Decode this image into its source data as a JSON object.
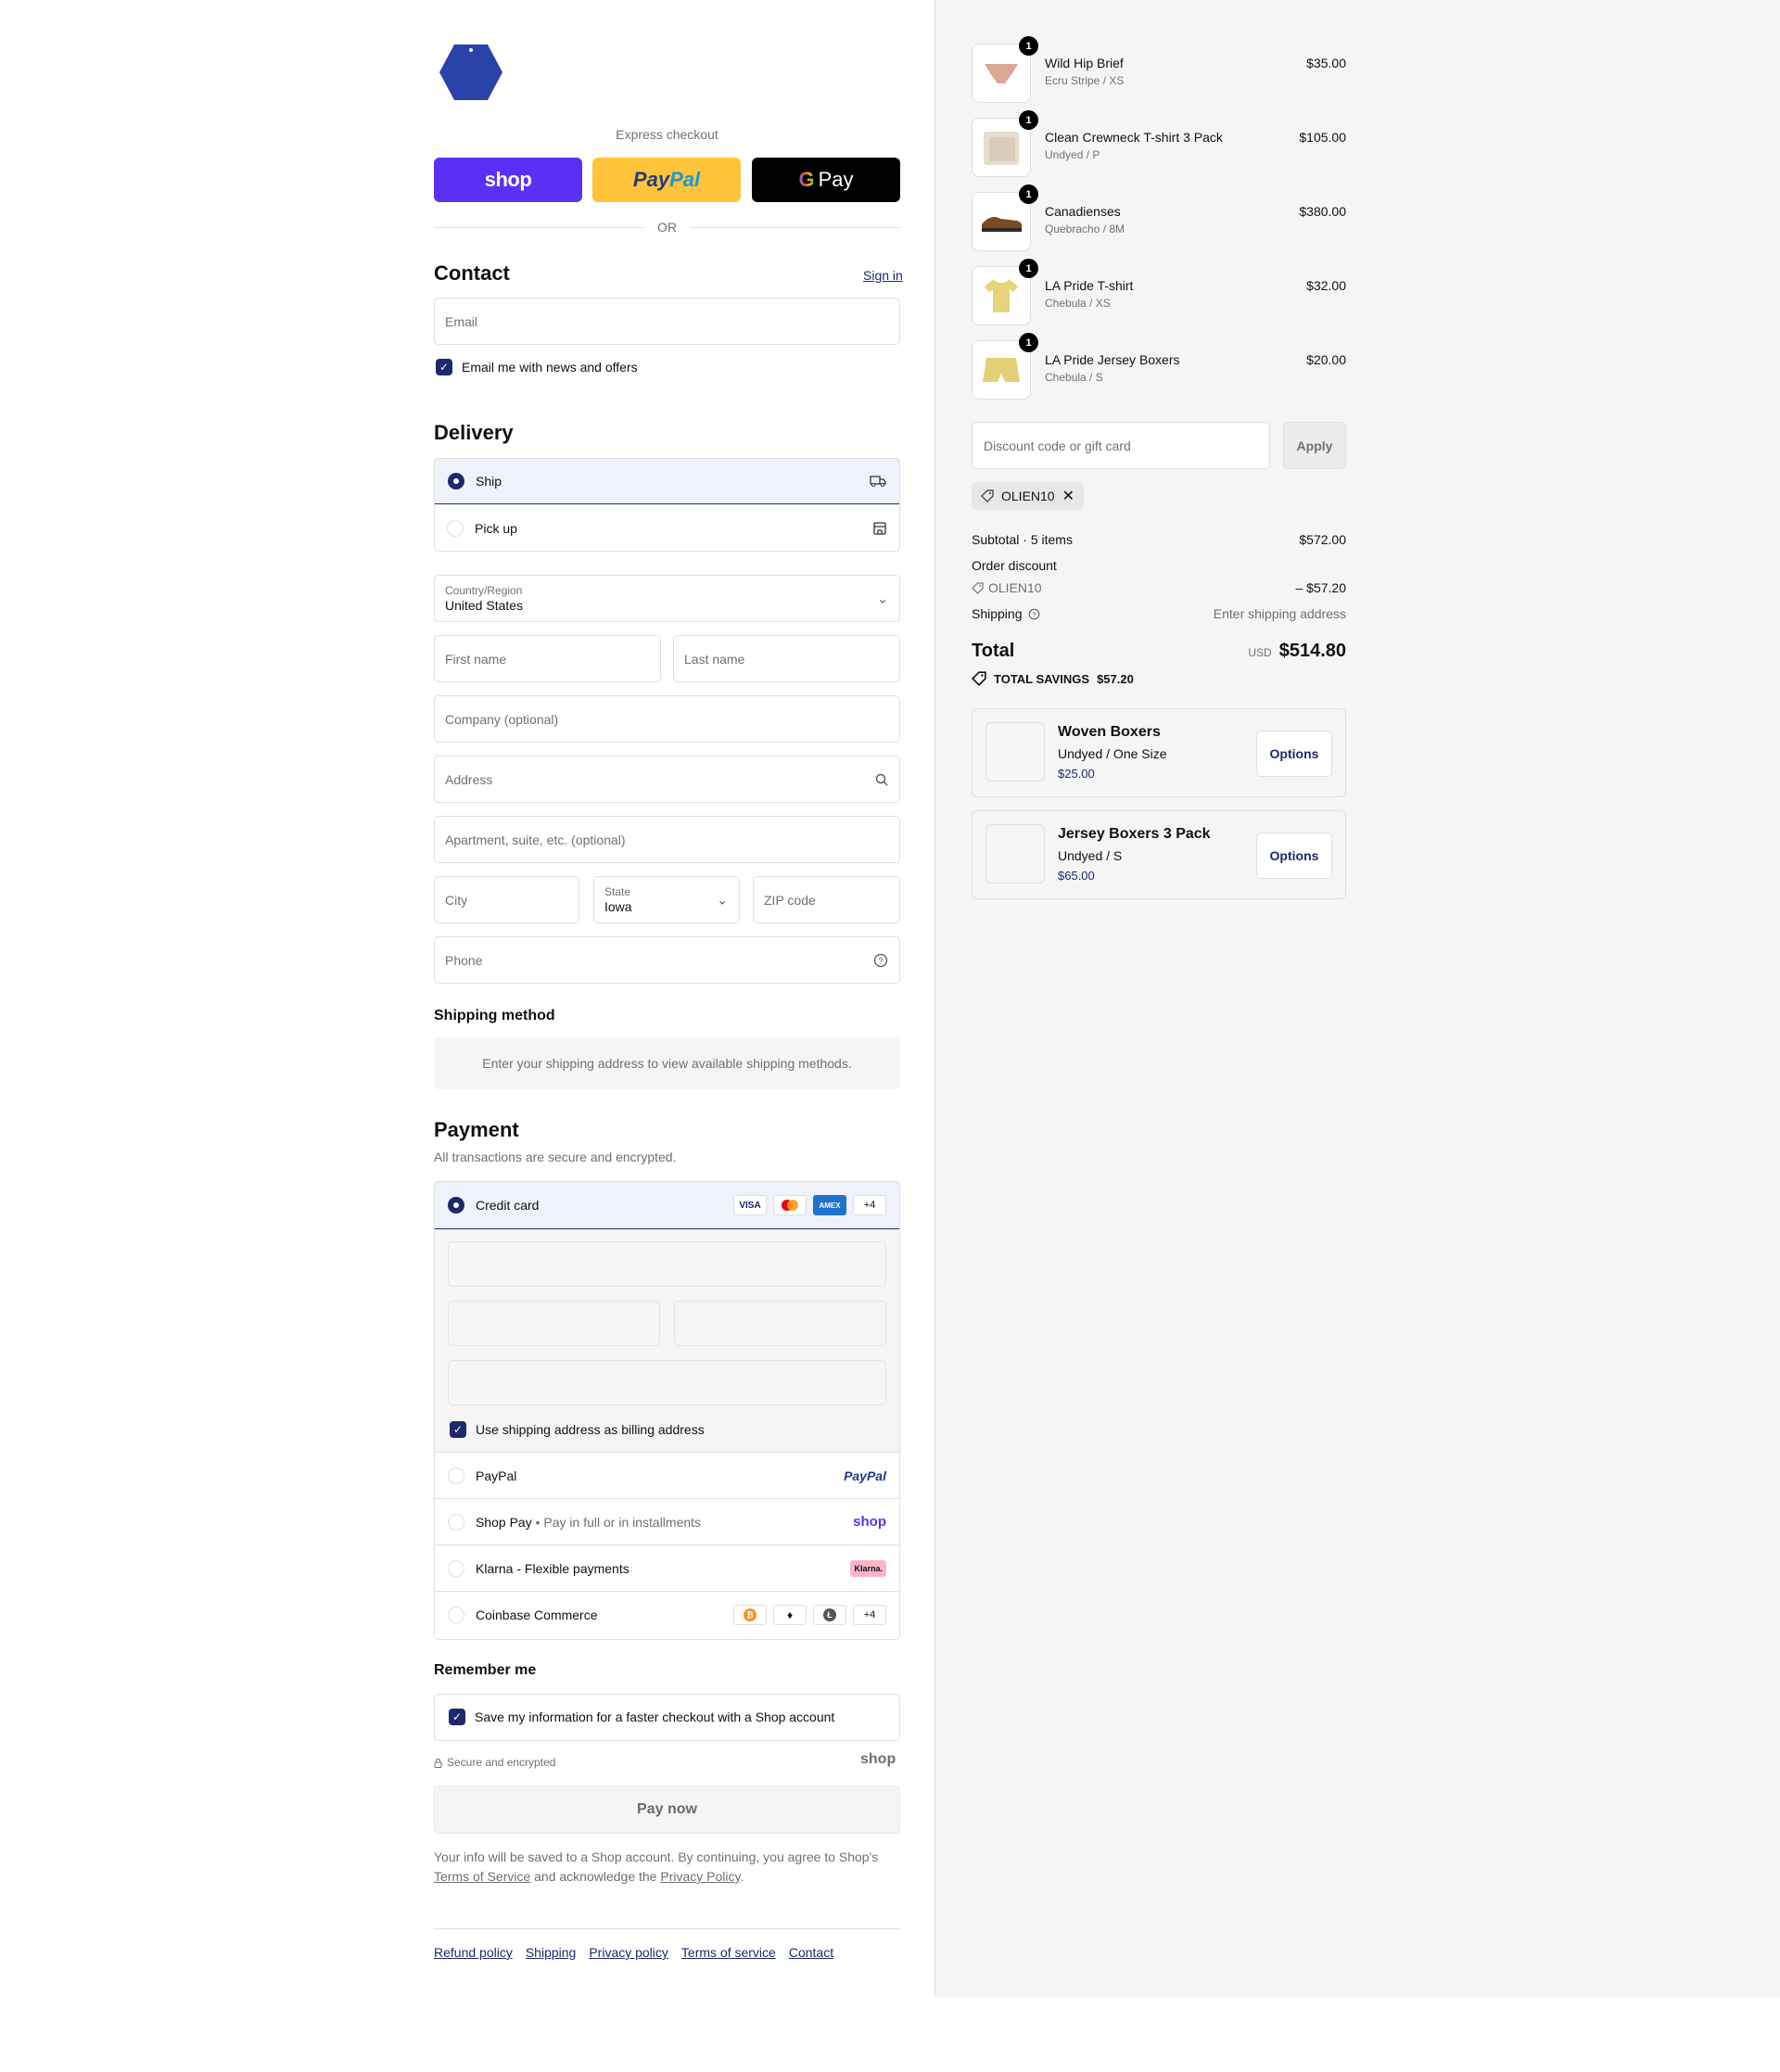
{
  "express": {
    "label": "Express checkout",
    "shop_label": "shop",
    "paypal_pay": "Pay",
    "paypal_pal": "Pal",
    "gpay_g": "G",
    "gpay_label": "Pay",
    "or_label": "OR"
  },
  "contact": {
    "title": "Contact",
    "sign_in": "Sign in",
    "email_placeholder": "Email",
    "news_label": "Email me with news and offers"
  },
  "delivery": {
    "title": "Delivery",
    "ship_label": "Ship",
    "pickup_label": "Pick up",
    "country_label": "Country/Region",
    "country_value": "United States",
    "first_name": "First name",
    "last_name": "Last name",
    "company": "Company (optional)",
    "address": "Address",
    "apartment": "Apartment, suite, etc. (optional)",
    "city": "City",
    "state_label": "State",
    "state_value": "Iowa",
    "zip": "ZIP code",
    "phone": "Phone"
  },
  "shipping_method": {
    "title": "Shipping method",
    "notice": "Enter your shipping address to view available shipping methods."
  },
  "payment": {
    "title": "Payment",
    "subtitle": "All transactions are secure and encrypted.",
    "credit_card": "Credit card",
    "card_badges": [
      "VISA",
      "MC",
      "AMEX",
      "+4"
    ],
    "billing_same": "Use shipping address as billing address",
    "paypal": "PayPal",
    "paypal_logo": "PayPal",
    "shop_pay": "Shop Pay",
    "shop_pay_sub": "Pay in full or in installments",
    "shop_pay_logo": "shop",
    "klarna": "Klarna - Flexible payments",
    "klarna_logo": "Klarna.",
    "coinbase": "Coinbase Commerce",
    "coinbase_more": "+4"
  },
  "remember": {
    "title": "Remember me",
    "save_label": "Save my information for a faster checkout with a Shop account",
    "secure_label": "Secure and encrypted",
    "shop_logo": "shop"
  },
  "pay_now": "Pay now",
  "disclaimer": {
    "text": "Your info will be saved to a Shop account. By continuing, you agree to Shop's",
    "tos": "Terms of Service",
    "mid": " and acknowledge the ",
    "privacy": "Privacy Policy",
    "end": "."
  },
  "footer": [
    "Refund policy",
    "Shipping",
    "Privacy policy",
    "Terms of service",
    "Contact"
  ],
  "cart": {
    "items": [
      {
        "name": "Wild Hip Brief",
        "variant": "Ecru Stripe / XS",
        "price": "$35.00",
        "qty": "1"
      },
      {
        "name": "Clean Crewneck T-shirt 3 Pack",
        "variant": "Undyed / P",
        "price": "$105.00",
        "qty": "1"
      },
      {
        "name": "Canadienses",
        "variant": "Quebracho / 8M",
        "price": "$380.00",
        "qty": "1"
      },
      {
        "name": "LA Pride T-shirt",
        "variant": "Chebula / XS",
        "price": "$32.00",
        "qty": "1"
      },
      {
        "name": "LA Pride Jersey Boxers",
        "variant": "Chebula / S",
        "price": "$20.00",
        "qty": "1"
      }
    ],
    "discount_placeholder": "Discount code or gift card",
    "apply_label": "Apply",
    "code": "OLIEN10",
    "subtotal_label": "Subtotal · 5 items",
    "subtotal_value": "$572.00",
    "order_discount_label": "Order discount",
    "discount_code_label": "OLIEN10",
    "discount_value": "– $57.20",
    "shipping_label": "Shipping",
    "shipping_value": "Enter shipping address",
    "total_label": "Total",
    "currency": "USD",
    "total_value": "$514.80",
    "savings_label": "TOTAL SAVINGS",
    "savings_value": "$57.20",
    "upsells": [
      {
        "name": "Woven Boxers",
        "variant": "Undyed / One Size",
        "price": "$25.00",
        "button": "Options"
      },
      {
        "name": "Jersey Boxers 3 Pack",
        "variant": "Undyed / S",
        "price": "$65.00",
        "button": "Options"
      }
    ]
  },
  "colors": {
    "accent": "#1c2a6b",
    "shop_purple": "#5a31f4",
    "paypal_yellow": "#ffc439",
    "summary_bg": "#f5f5f5"
  }
}
